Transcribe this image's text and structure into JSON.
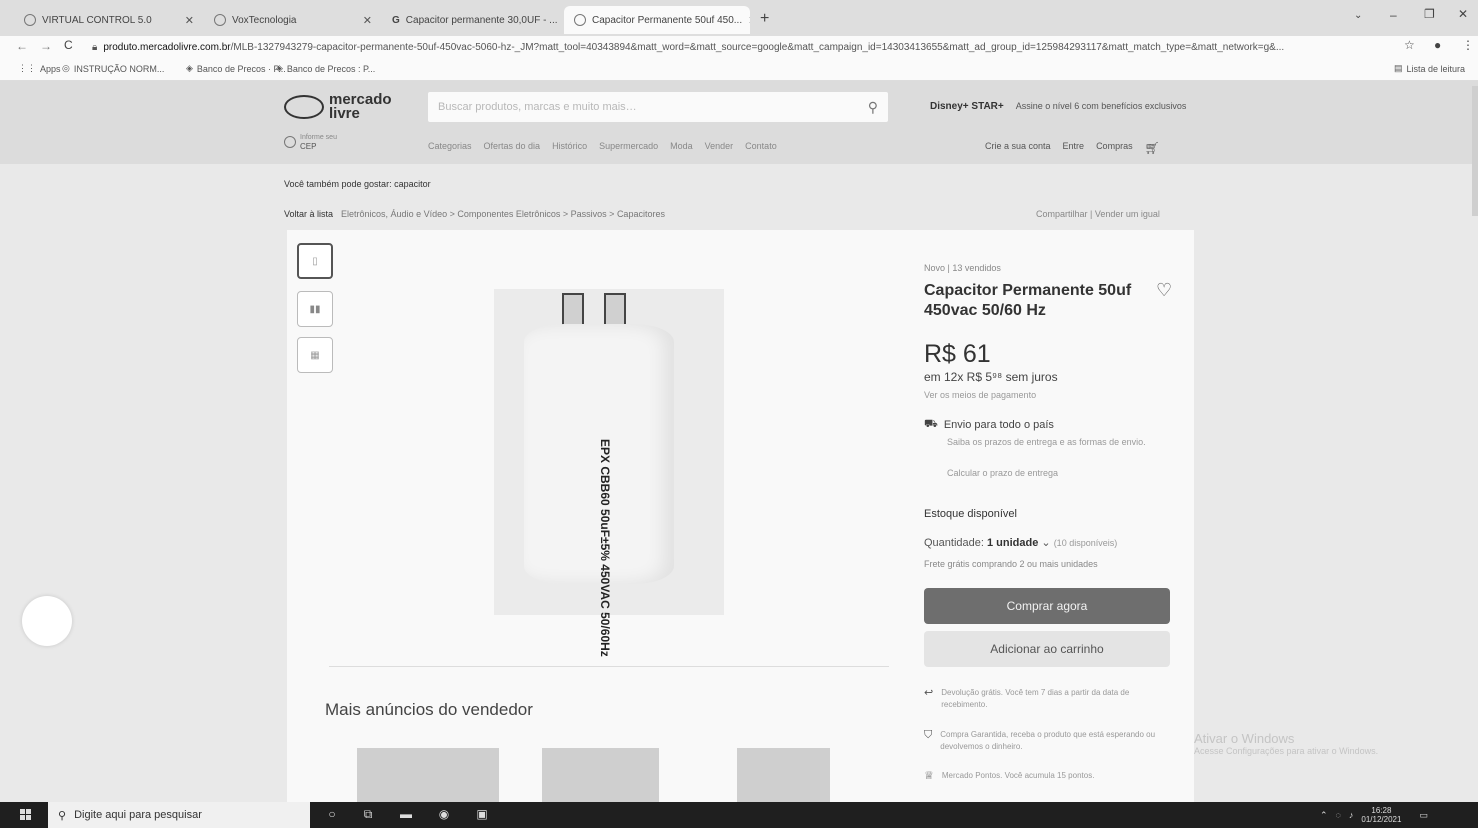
{
  "tabs": [
    {
      "label": "VIRTUAL CONTROL 5.0"
    },
    {
      "label": "VoxTecnologia"
    },
    {
      "label": "Capacitor permanente 30,0UF - ..."
    },
    {
      "label": "Capacitor Permanente 50uf 450..."
    }
  ],
  "address": {
    "domain": "produto.mercadolivre.com.br",
    "path": "/MLB-1327943279-capacitor-permanente-50uf-450vac-5060-hz-_JM?matt_tool=40343894&matt_word=&matt_source=google&matt_campaign_id=14303413655&matt_ad_group_id=125984293117&matt_match_type=&matt_network=g&..."
  },
  "bookmarks": [
    {
      "label": "Apps"
    },
    {
      "label": "INSTRUÇÃO NORM..."
    },
    {
      "label": "Banco de Precos · P..."
    },
    {
      "label": "Banco de Precos : P..."
    }
  ],
  "reading_list": "Lista de leitura",
  "header": {
    "logo_text": "mercado livre",
    "search_placeholder": "Buscar produtos, marcas e muito mais…",
    "disney_brand": "Disney+ STAR+",
    "disney_promo": "Assine o nível 6 com benefícios exclusivos",
    "cep_small": "Informe seu",
    "cep_label": "CEP",
    "nav": [
      "Categorias",
      "Ofertas do dia",
      "Histórico",
      "Supermercado",
      "Moda",
      "Vender",
      "Contato"
    ],
    "account": [
      "Crie a sua conta",
      "Entre",
      "Compras"
    ]
  },
  "suggest": "Você também pode gostar: capacitor",
  "breadcrumbs": {
    "back": "Voltar à lista",
    "path": "Eletrônicos, Áudio e Vídeo > Componentes Eletrônicos > Passivos > Capacitores"
  },
  "share": "Compartilhar  |  Vender um igual",
  "product": {
    "image_marking": "EPX CBB60 50uF±5% 450VAC 50/60Hz",
    "condition": "Novo  |  13 vendidos",
    "title": "Capacitor Permanente 50uf 450vac 50/60 Hz",
    "price": "R$ 61",
    "installments": "em 12x R$ 5⁹⁸ sem juros",
    "payment_link": "Ver os meios de pagamento",
    "shipping_title": "Envio para todo o país",
    "shipping_sub": "Saiba os prazos de entrega e as formas de envio.",
    "shipping_calc": "Calcular o prazo de entrega",
    "stock": "Estoque disponível",
    "qty_label": "Quantidade:",
    "qty_value": "1 unidade",
    "qty_available": "(10 disponíveis)",
    "free_shipping": "Frete grátis comprando 2 ou mais unidades",
    "buy_label": "Comprar agora",
    "cart_label": "Adicionar ao carrinho",
    "perks": [
      "Devolução grátis. Você tem 7 dias a partir da data de recebimento.",
      "Compra Garantida, receba o produto que está esperando ou devolvemos o dinheiro.",
      "Mercado Pontos. Você acumula 15 pontos."
    ]
  },
  "more_ads": "Mais anúncios do vendedor",
  "watermark": {
    "line1": "Ativar o Windows",
    "line2": "Acesse Configurações para ativar o Windows."
  },
  "taskbar": {
    "search": "Digite aqui para pesquisar",
    "time": "16:28",
    "date": "01/12/2021"
  }
}
